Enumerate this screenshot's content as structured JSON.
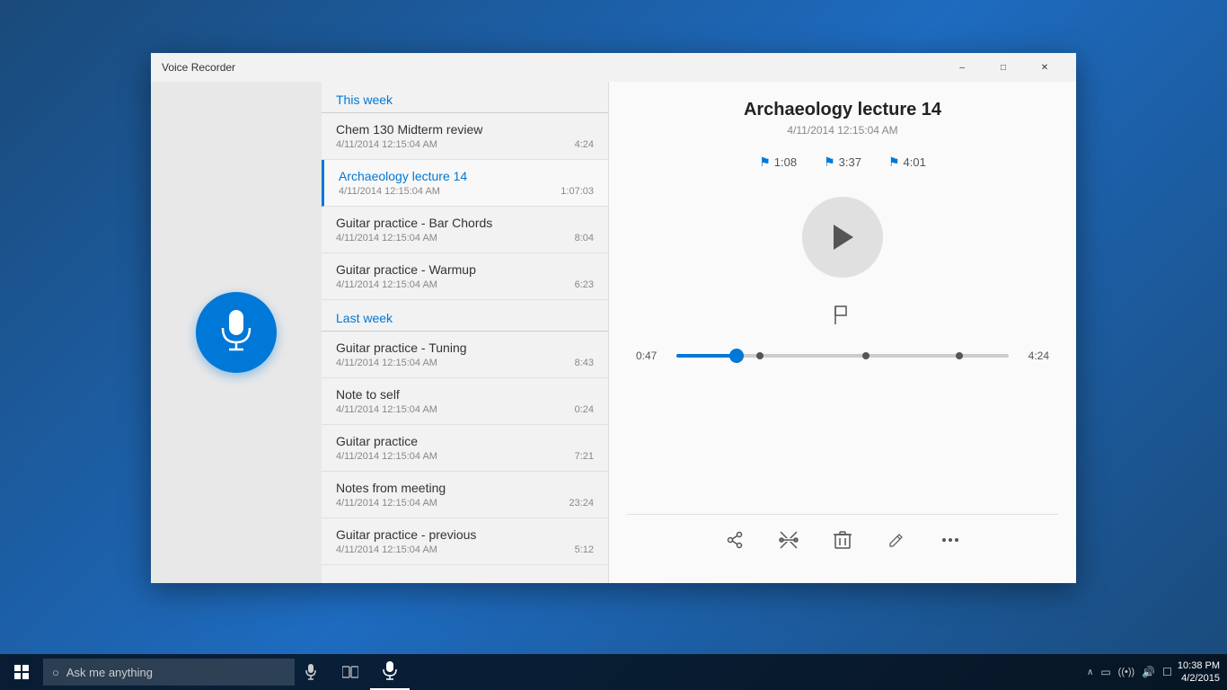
{
  "window": {
    "title": "Voice Recorder",
    "minimize_label": "–",
    "maximize_label": "□",
    "close_label": "✕"
  },
  "sections": {
    "this_week": "This week",
    "last_week": "Last week"
  },
  "recordings": [
    {
      "id": 1,
      "title": "Chem 130 Midterm review",
      "date": "4/11/2014 12:15:04 AM",
      "duration": "4:24",
      "active": false,
      "section": "this_week"
    },
    {
      "id": 2,
      "title": "Archaeology lecture 14",
      "date": "4/11/2014 12:15:04 AM",
      "duration": "1:07:03",
      "active": true,
      "section": "this_week"
    },
    {
      "id": 3,
      "title": "Guitar practice - Bar Chords",
      "date": "4/11/2014 12:15:04 AM",
      "duration": "8:04",
      "active": false,
      "section": "this_week"
    },
    {
      "id": 4,
      "title": "Guitar practice - Warmup",
      "date": "4/11/2014 12:15:04 AM",
      "duration": "6:23",
      "active": false,
      "section": "this_week"
    },
    {
      "id": 5,
      "title": "Guitar practice - Tuning",
      "date": "4/11/2014 12:15:04 AM",
      "duration": "8:43",
      "active": false,
      "section": "last_week"
    },
    {
      "id": 6,
      "title": "Note to self",
      "date": "4/11/2014 12:15:04 AM",
      "duration": "0:24",
      "active": false,
      "section": "last_week"
    },
    {
      "id": 7,
      "title": "Guitar practice",
      "date": "4/11/2014 12:15:04 AM",
      "duration": "7:21",
      "active": false,
      "section": "last_week"
    },
    {
      "id": 8,
      "title": "Notes from meeting",
      "date": "4/11/2014 12:15:04 AM",
      "duration": "23:24",
      "active": false,
      "section": "last_week"
    },
    {
      "id": 9,
      "title": "Guitar practice - previous",
      "date": "4/11/2014 12:15:04 AM",
      "duration": "5:12",
      "active": false,
      "section": "last_week"
    }
  ],
  "player": {
    "title": "Archaeology lecture 14",
    "date": "4/11/2014 12:15:04 AM",
    "markers": [
      {
        "time": "1:08"
      },
      {
        "time": "3:37"
      },
      {
        "time": "4:01"
      }
    ],
    "current_time": "0:47",
    "total_time": "4:24",
    "progress_percent": 18
  },
  "toolbar": {
    "share_icon": "🔊",
    "trim_icon": "✂",
    "delete_icon": "🗑",
    "rename_icon": "✏",
    "more_icon": "⋯"
  },
  "taskbar": {
    "search_placeholder": "Ask me anything",
    "time": "10:38 PM",
    "date": "4/2/2015"
  }
}
